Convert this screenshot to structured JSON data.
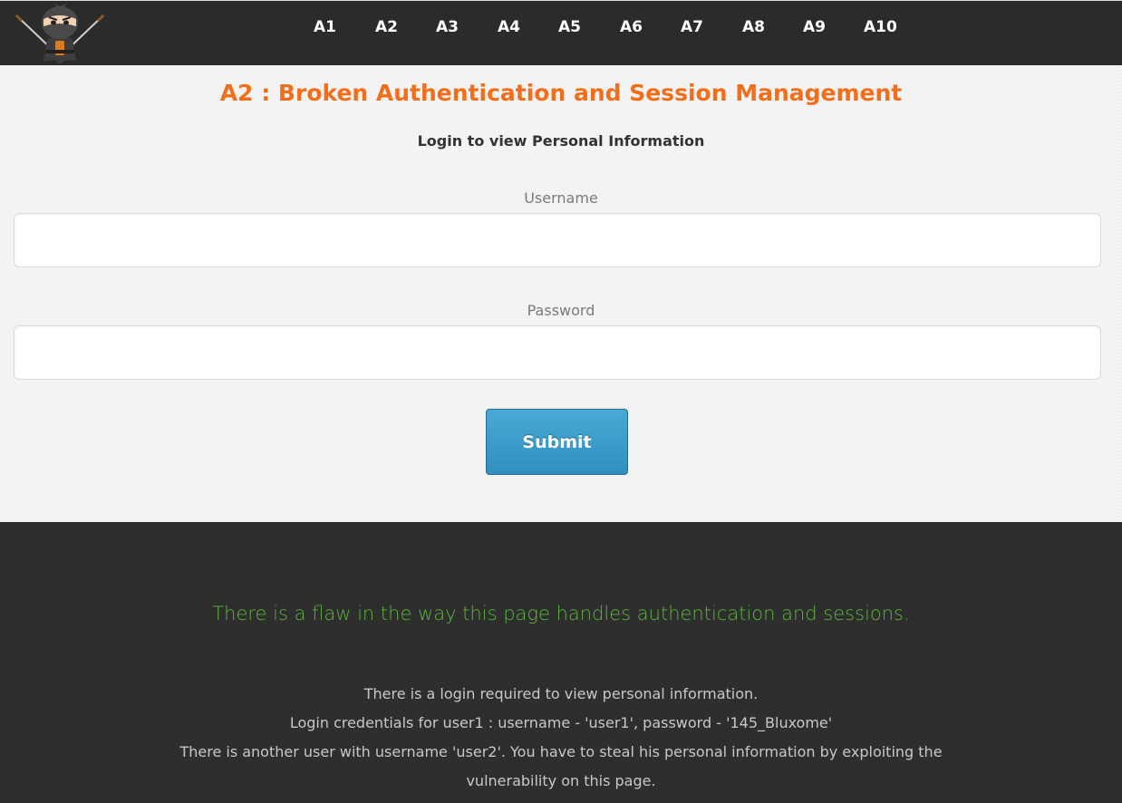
{
  "nav": {
    "items": [
      {
        "label": "A1"
      },
      {
        "label": "A2"
      },
      {
        "label": "A3"
      },
      {
        "label": "A4"
      },
      {
        "label": "A5"
      },
      {
        "label": "A6"
      },
      {
        "label": "A7"
      },
      {
        "label": "A8"
      },
      {
        "label": "A9"
      },
      {
        "label": "A10"
      }
    ]
  },
  "logo": {
    "icon": "ninja-mascot-icon"
  },
  "main": {
    "title": "A2 : Broken Authentication and Session Management",
    "subtitle": "Login to view Personal Information",
    "username": {
      "label": "Username",
      "value": "",
      "placeholder": ""
    },
    "password": {
      "label": "Password",
      "value": "",
      "placeholder": ""
    },
    "submit_label": "Submit"
  },
  "footer": {
    "hint": "There is a flaw in the way this page handles authentication and sessions.",
    "info_lines": [
      "There is a login required to view personal information.",
      "Login credentials for user1 : username - 'user1', password - '145_Bluxome'",
      "There is another user with username 'user2'. You have to steal his personal information by exploiting the",
      "vulnerability on this page."
    ]
  },
  "colors": {
    "nav_bg": "#2b2b2b",
    "title": "#f26e1b",
    "button": "#3a9bcb",
    "hint": "#5bb53c",
    "footer_bg": "#2e2e2e"
  }
}
